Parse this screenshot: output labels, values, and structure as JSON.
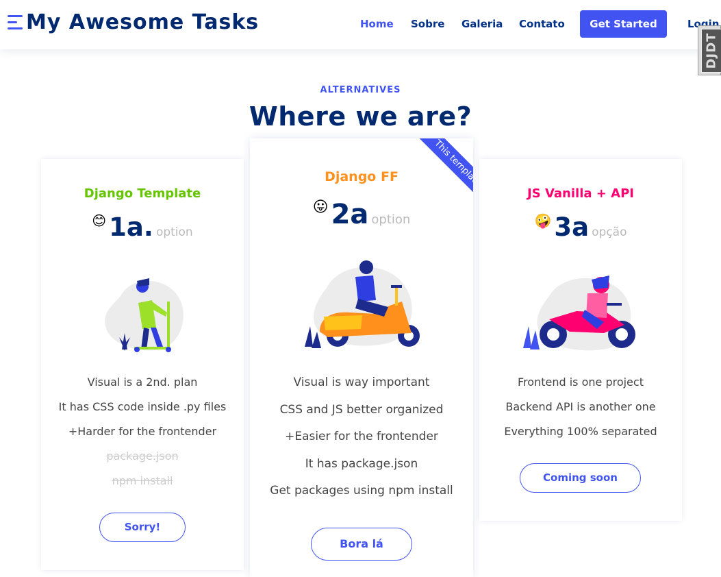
{
  "header": {
    "logo_text": "My Awesome Tasks",
    "nav": [
      {
        "label": "Home",
        "active": true
      },
      {
        "label": "Sobre"
      },
      {
        "label": "Galeria"
      },
      {
        "label": "Contato"
      }
    ],
    "cta_label": "Get Started",
    "login_label": "Login"
  },
  "debug_toolbar": {
    "label": "DJDT"
  },
  "section": {
    "subtitle": "ALTERNATIVES",
    "title": "Where we are?"
  },
  "cards": [
    {
      "title": "Django Template",
      "title_color": "#65c600",
      "emoji": "😊",
      "number": "1a.",
      "unit": "option",
      "features": [
        {
          "text": "Visual is a 2nd. plan",
          "available": true
        },
        {
          "text": "It has CSS code inside .py files",
          "available": true
        },
        {
          "text": "+Harder for the frontender",
          "available": true
        },
        {
          "text": "package.json",
          "available": false
        },
        {
          "text": "npm install",
          "available": false
        }
      ],
      "button": "Sorry!"
    },
    {
      "title": "Django FF",
      "title_color": "#ff901c",
      "emoji": "😛",
      "number": "2a",
      "unit": "option",
      "ribbon": "This template",
      "features": [
        {
          "text": "Visual is way important",
          "available": true
        },
        {
          "text": "CSS and JS better organized",
          "available": true
        },
        {
          "text": "+Easier for the frontender",
          "available": true
        },
        {
          "text": "It has package.json",
          "available": true
        },
        {
          "text": "Get packages using npm install",
          "available": true
        }
      ],
      "button": "Bora lá"
    },
    {
      "title": "JS Vanilla + API",
      "title_color": "#ff0071",
      "emoji": "🤪",
      "number": "3a",
      "unit": "opção",
      "features": [
        {
          "text": "Frontend is one project",
          "available": true
        },
        {
          "text": "Backend API is another one",
          "available": true
        },
        {
          "text": "Everything 100% separated",
          "available": true
        }
      ],
      "button": "Coming soon"
    }
  ],
  "illustrations": {
    "card1": "scooter-kick-illustration",
    "card2": "motor-scooter-illustration",
    "card3": "motorcycle-illustration"
  },
  "colors": {
    "accent": "#4154f1",
    "navy": "#012970",
    "orange": "#ff901c",
    "pink": "#ff0071",
    "green": "#65c600"
  }
}
